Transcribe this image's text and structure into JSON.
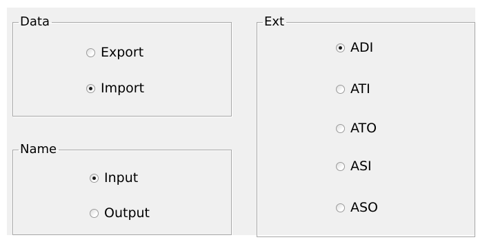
{
  "data_group": {
    "title": "Data",
    "options": [
      {
        "label": "Export",
        "checked": false
      },
      {
        "label": "Import",
        "checked": true
      }
    ]
  },
  "name_group": {
    "title": "Name",
    "options": [
      {
        "label": "Input",
        "checked": true
      },
      {
        "label": "Output",
        "checked": false
      }
    ]
  },
  "ext_group": {
    "title": "Ext",
    "options": [
      {
        "label": "ADI",
        "checked": true
      },
      {
        "label": "ATI",
        "checked": false
      },
      {
        "label": "ATO",
        "checked": false
      },
      {
        "label": "ASI",
        "checked": false
      },
      {
        "label": "ASO",
        "checked": false
      }
    ]
  }
}
